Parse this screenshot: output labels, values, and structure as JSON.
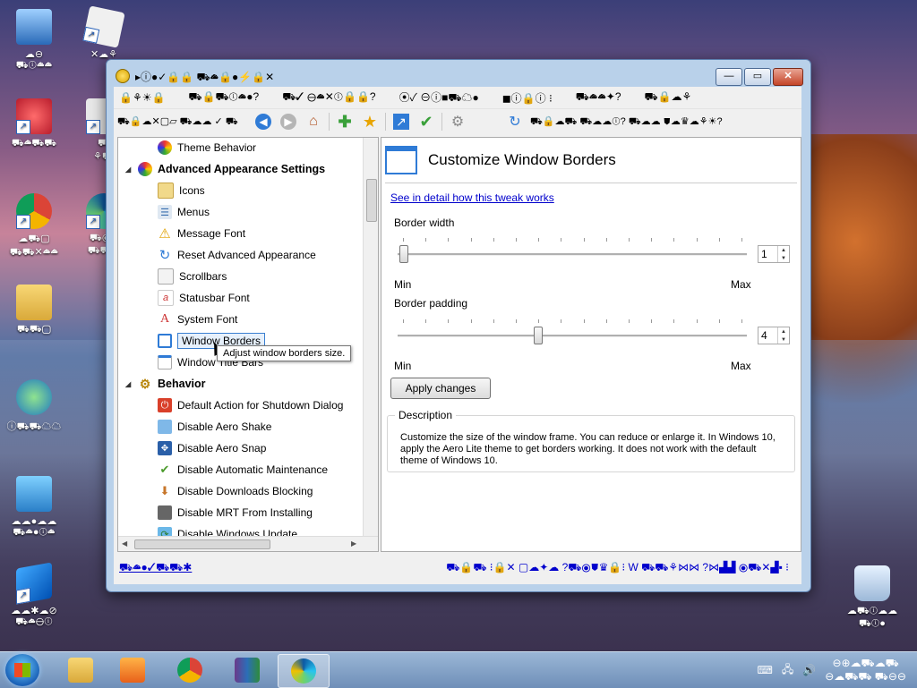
{
  "window": {
    "title": "▸ⓘ●✓🔒🔒 ⛟☁🔒●⚡🔒✕"
  },
  "menu": [
    "🔒⚘☀🔒",
    "⛟🔒⛟ⓘ☁●?",
    "⛟✓ ⊖☁✕ⓘ🔒🔒?",
    "⦿✓ ⊖ⓘ■⛟☁●",
    "◼ⓘ🔒ⓘ ⁝",
    "⛟☁☁✦?",
    "⛟🔒☁⚘"
  ],
  "toolbar": {
    "search_label": "⛟🔒☁✕▢▱ ⛟☁☁ ✓ ⛟",
    "goto_label": "⛟🔒☁⛟ ⛟☁☁ⓘ? ⛟☁☁ ⛊☁♛☁⚘☀?"
  },
  "tree": {
    "items": [
      {
        "label": "Theme Behavior",
        "type": "item"
      },
      {
        "label": "Advanced Appearance Settings",
        "type": "category"
      },
      {
        "label": "Icons",
        "type": "item"
      },
      {
        "label": "Menus",
        "type": "item"
      },
      {
        "label": "Message Font",
        "type": "item"
      },
      {
        "label": "Reset Advanced Appearance",
        "type": "item"
      },
      {
        "label": "Scrollbars",
        "type": "item"
      },
      {
        "label": "Statusbar Font",
        "type": "item"
      },
      {
        "label": "System Font",
        "type": "item"
      },
      {
        "label": "Window Borders",
        "type": "item"
      },
      {
        "label": "Window Title Bars",
        "type": "item"
      },
      {
        "label": "Behavior",
        "type": "category"
      },
      {
        "label": "Default Action for Shutdown Dialog",
        "type": "item"
      },
      {
        "label": "Disable Aero Shake",
        "type": "item"
      },
      {
        "label": "Disable Aero Snap",
        "type": "item"
      },
      {
        "label": "Disable Automatic Maintenance",
        "type": "item"
      },
      {
        "label": "Disable Downloads Blocking",
        "type": "item"
      },
      {
        "label": "Disable MRT From Installing",
        "type": "item"
      },
      {
        "label": "Disable Windows Update",
        "type": "item"
      }
    ],
    "tooltip": "Adjust window borders size."
  },
  "panel": {
    "title": "Customize Window Borders",
    "link": "See in detail how this tweak works",
    "border_width_label": "Border width",
    "border_width_value": "1",
    "border_width_fraction": 0.0,
    "border_padding_label": "Border padding",
    "border_padding_value": "4",
    "border_padding_fraction": 0.4,
    "min_label": "Min",
    "max_label": "Max",
    "apply_label": "Apply changes",
    "description_title": "Description",
    "description": "Customize the size of the window frame. You can reduce or enlarge it. In Windows 10, apply the Aero Lite theme to get borders working. It does not work with the default theme of Windows 10."
  },
  "statusbar": {
    "left": "⛟☁●✓⛟⛟✱",
    "right": "⛟🔒⛟ ⁝🔒✕ ▢☁✦☁ ?⛟⦿⛊♛🔒⁝ W ⛟⛟⚘⋈⋈ ?⋈▟▟ ⦿⛟✕▟▪ ⁝"
  },
  "desktop": {
    "icons": [
      {
        "label": "☁⊖\n⛟ⓘ☁☁"
      },
      {
        "label": "✕☁⚘"
      },
      {
        "label": "⛟☁⛟⛟"
      },
      {
        "label": "⛟\n⚘⛟"
      },
      {
        "label": "☁⛟▢\n⛟⛟✕☁☁"
      },
      {
        "label": "⛟⦿☁\n⛟⛟☁"
      },
      {
        "label": "⛟⛟▢"
      },
      {
        "label": "ⓘ⛟⛟☁☁"
      },
      {
        "label": "☁☁●☁☁\n⛟☁●ⓘ☁"
      },
      {
        "label": "☁☁✱☁⊘\n⛟☁⊖ⓘ"
      },
      {
        "label": "☁⛟ⓘ☁☁\n⛟ⓘ●"
      }
    ]
  },
  "taskbar": {
    "tray_time": "⊖⊕☁⛟☁⛟",
    "tray_date": "⊖☁⛟⛟ ⛟⊖⊖"
  },
  "colors": {
    "accent": "#2f7bd6",
    "link": "#0000cc",
    "titlebar": "#b9d1ea",
    "close": "#c44528"
  }
}
